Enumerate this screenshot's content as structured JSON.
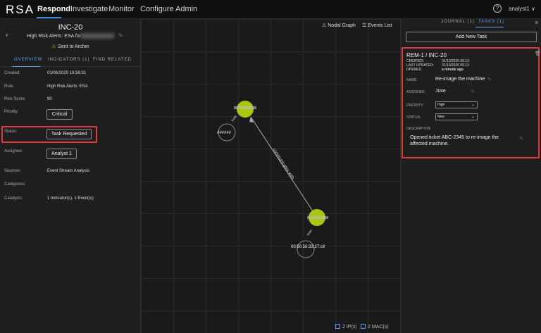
{
  "nav": {
    "logo": "RSA",
    "items": [
      "Respond",
      "Investigate",
      "Monitor",
      "Configure",
      "Admin"
    ],
    "help": "?",
    "user": "analyst1 ∨"
  },
  "incident": {
    "id": "INC-20",
    "back": "‹",
    "subtitle": "High Risk Alerts: ESA for",
    "archer": "Sent to Archer",
    "tabs": [
      "OVERVIEW",
      "INDICATORS (1)",
      "FIND RELATED"
    ],
    "fields": {
      "created_label": "Created:",
      "created": "01/06/2020 19:58:31",
      "rule_label": "Rule:",
      "rule": "High Risk Alerts: ESA",
      "risk_label": "Risk Score:",
      "risk": "90",
      "priority_label": "Priority:",
      "priority": "Critical",
      "status_label": "Status:",
      "status": "Task Requested",
      "assignee_label": "Assignee:",
      "assignee": "Analyst 1",
      "sources_label": "Sources:",
      "sources": "Event Stream Analysis",
      "categories_label": "Categories:",
      "catalysts_label": "Catalysts:",
      "catalysts": "1 Indicator(s), 1 Event(s)"
    }
  },
  "graph": {
    "tab_nodal": "Nodal Graph",
    "tab_events": "Events List",
    "node1_label": "######",
    "node2_label": "00:50:56:33:27:c9",
    "edge_label": "communicates with",
    "node1_tag": "host",
    "node2_tag": "mac",
    "legend_ip": "2 IP(s)",
    "legend_mac": "2 MAC(s)"
  },
  "right": {
    "tab_journal": "JOURNAL (1)",
    "tab_tasks": "TASKS (1)",
    "close": "×",
    "add_task": "Add New Task",
    "task": {
      "title": "REM-1 / INC-20",
      "created_label": "CREATED:",
      "created": "01/10/2020 00:13",
      "updated_label": "LAST UPDATED:",
      "updated": "01/10/2020 00:13",
      "opened_label": "OPENED",
      "opened": "a minute ago",
      "name_label": "NAME",
      "name": "Re-image the machine",
      "assignee_label": "ASSIGNEE:",
      "assignee": "Jose",
      "priority_label": "PRIORITY:",
      "priority": "High",
      "status_label": "STATUS:",
      "status": "New",
      "desc_label": "DESCRIPTION",
      "desc": "Opened ticket ABC-2345 to re-image the affected machine."
    }
  },
  "colors": {
    "accent": "#3d8be0",
    "highlight": "#e0393e",
    "node": "#a8c80f"
  }
}
